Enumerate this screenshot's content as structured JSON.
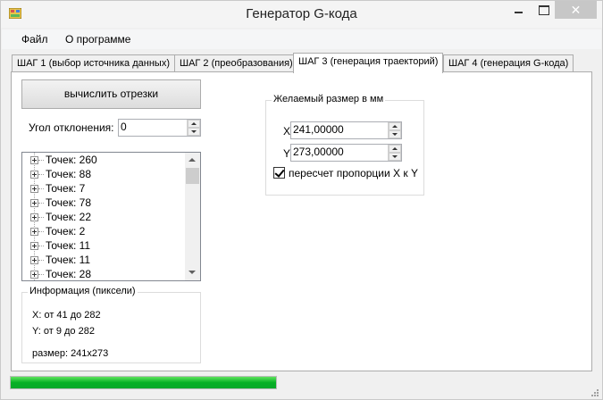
{
  "window": {
    "title": "Генератор G-кода",
    "close_label": "✕"
  },
  "menu": {
    "items": [
      "Файл",
      "О программе"
    ]
  },
  "tabs": [
    {
      "label": "ШАГ 1 (выбор источника данных)"
    },
    {
      "label": "ШАГ 2 (преобразования)"
    },
    {
      "label": "ШАГ 3 (генерация траекторий)"
    },
    {
      "label": "ШАГ 4 (генерация G-кода)"
    }
  ],
  "active_tab": 2,
  "step3": {
    "compute_button": "вычислить отрезки",
    "angle_label": "Угол отклонения:",
    "angle_value": "0",
    "points": [
      "Точек: 260",
      "Точек: 88",
      "Точек: 7",
      "Точек: 78",
      "Точек: 22",
      "Точек: 2",
      "Точек: 11",
      "Точек: 11",
      "Точек: 28"
    ],
    "info": {
      "title": "Информация (пиксели)",
      "x_range": "X: от 41 до 282",
      "y_range": "Y: от 9 до 282",
      "size": "размер: 241x273"
    },
    "desired_size": {
      "title": "Желаемый размер в мм",
      "x_label": "X:",
      "x_value": "241,00000",
      "y_label": "Y:",
      "y_value": "273,00000",
      "proportion_label": "пересчет пропорции X к Y",
      "proportion_checked": true
    }
  },
  "progress": {
    "percent": 100
  },
  "colors": {
    "progress_green": "#06b025",
    "close_button_bg": "#c7c7c7"
  }
}
